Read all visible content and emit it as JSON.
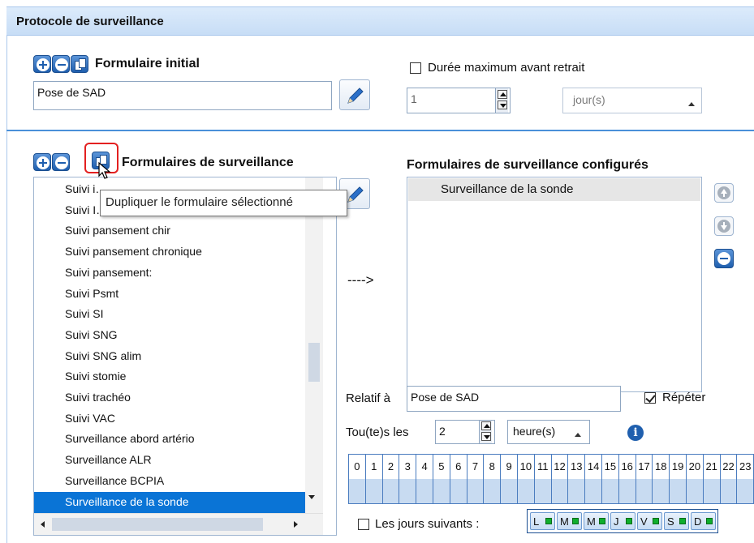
{
  "panel": {
    "title": "Protocole de surveillance"
  },
  "initial_form": {
    "heading": "Formulaire initial",
    "value": "Pose de SAD",
    "max_duration_label": "Durée maximum avant retrait",
    "max_duration_checked": false,
    "duration_value": "1",
    "duration_unit": "jour(s)"
  },
  "surveillance_forms": {
    "heading": "Formulaires de surveillance",
    "items": [
      {
        "label": "Suivi i…",
        "selected": false
      },
      {
        "label": "Suivi I…",
        "selected": false
      },
      {
        "label": "Suivi pansement chir",
        "selected": false
      },
      {
        "label": "Suivi pansement chronique",
        "selected": false
      },
      {
        "label": "Suivi pansement:",
        "selected": false
      },
      {
        "label": "Suivi Psmt",
        "selected": false
      },
      {
        "label": "Suivi SI",
        "selected": false
      },
      {
        "label": "Suivi SNG",
        "selected": false
      },
      {
        "label": "Suivi SNG alim",
        "selected": false
      },
      {
        "label": "Suivi stomie",
        "selected": false
      },
      {
        "label": "Suivi trachéo",
        "selected": false
      },
      {
        "label": "Suivi VAC",
        "selected": false
      },
      {
        "label": "Surveillance abord artério",
        "selected": false
      },
      {
        "label": "Surveillance ALR",
        "selected": false
      },
      {
        "label": "Surveillance BCPIA",
        "selected": false
      },
      {
        "label": "Surveillance de la sonde",
        "selected": true
      }
    ]
  },
  "tooltip": {
    "text": "Dupliquer le formulaire sélectionné"
  },
  "arrow_label": "---->",
  "configured": {
    "heading": "Formulaires de surveillance configurés",
    "items": [
      "Surveillance de la sonde"
    ]
  },
  "relative": {
    "label": "Relatif à",
    "value": "Pose de SAD"
  },
  "repeat": {
    "label": "Répéter",
    "checked": true
  },
  "every": {
    "label": "Tou(te)s les",
    "value": "2",
    "unit": "heure(s)"
  },
  "hours": [
    "0",
    "1",
    "2",
    "3",
    "4",
    "5",
    "6",
    "7",
    "8",
    "9",
    "10",
    "11",
    "12",
    "13",
    "14",
    "15",
    "16",
    "17",
    "18",
    "19",
    "20",
    "21",
    "22",
    "23"
  ],
  "following_days": {
    "label": "Les jours suivants :",
    "checked": false
  },
  "days": [
    "L",
    "M",
    "M",
    "J",
    "V",
    "S",
    "D"
  ],
  "colors": {
    "accent": "#1f5fae",
    "selection": "#0a74d6",
    "title_bg": "#d6e7f9",
    "day_active": "#0fae2d"
  }
}
